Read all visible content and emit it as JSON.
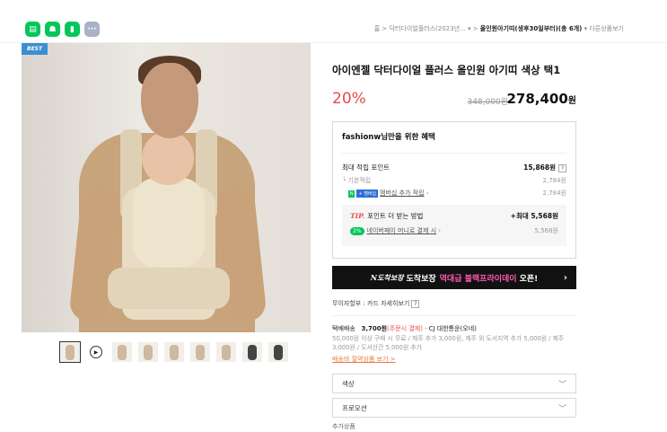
{
  "share": {
    "icons": [
      "talk-icon",
      "story-icon",
      "bookmark-icon",
      "more-icon"
    ]
  },
  "breadcrumb": {
    "home": "홈",
    "sep": ">",
    "cat1": "닥터다이얼플러스(2023년...",
    "cat2": "올인원아기띠(생후30일부터)(총 6개)",
    "other": "다른상품보기"
  },
  "product": {
    "badge": "BEST",
    "title": "아이엔젤 닥터다이얼 플러스 올인원 아기띠 색상 택1",
    "discount": "20%",
    "original_price": "348,000원",
    "final_price": "278,400",
    "final_unit": "원"
  },
  "benefit": {
    "title": "fashionw님만을 위한 혜택",
    "max_point_label": "최대 적립 포인트",
    "max_point_value": "15,868원",
    "q": "?",
    "basic_label": "기본적립",
    "basic_value": "2,784원",
    "n_badge": "N",
    "plus_badge": "+ 멤버십",
    "membership_link": "멤버십 추가 적립",
    "membership_value": "2,784원",
    "tip_label": "TIP.",
    "tip_text": "포인트 더 받는 방법",
    "tip_value": "+최대 5,568원",
    "np_badge": "2%",
    "np_link": "네이버페이 머니로 결제 시",
    "np_value": "5,568원"
  },
  "banner": {
    "brand": "N도착보장",
    "text": "도착보장",
    "pink": "역대급 블랙프라이데이",
    "suffix": "오픈!",
    "arrow": "›"
  },
  "card": {
    "text": "무이자할부 : 카드 자세히보기",
    "q": "?"
  },
  "shipping": {
    "label": "택배배송",
    "price": "3,700원",
    "note": "(주문시 결제)",
    "carrier": "· CJ 대한통운(오네)",
    "desc": "50,000원 이상 구매 시 무료 / 제주 추가 3,000원, 제주 외 도서지역 추가 5,000원 / 제주 3,000원 / 도서산간 5,000원 추가",
    "link": "배송비 절약상품 보기 >"
  },
  "options": [
    {
      "label": "색상"
    },
    {
      "label": "프로모션"
    }
  ],
  "more_label": "추가상품"
}
